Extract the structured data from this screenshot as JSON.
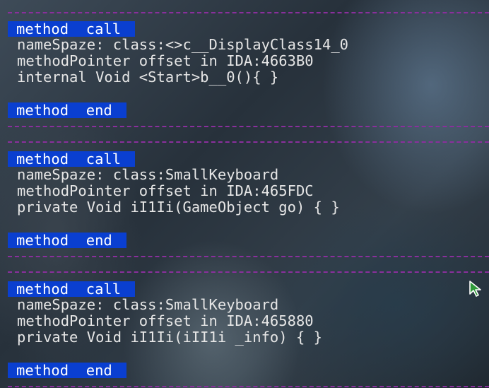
{
  "blocks": [
    {
      "header": "method  call",
      "namespace": "nameSpaze: class:<>c__DisplayClass14_0",
      "pointer": "methodPointer offset in IDA:4663B0",
      "signature": "internal Void <Start>b__0(){ }",
      "footer": "method  end"
    },
    {
      "header": "method  call",
      "namespace": "nameSpaze: class:SmallKeyboard",
      "pointer": "methodPointer offset in IDA:465FDC",
      "signature": "private Void iI1Ii(GameObject go) { }",
      "footer": "method  end"
    },
    {
      "header": "method  call",
      "namespace": "nameSpaze: class:SmallKeyboard",
      "pointer": "methodPointer offset in IDA:465880",
      "signature": "private Void iI1Ii(iII1i _info) { }",
      "footer": "method  end"
    }
  ],
  "colors": {
    "header_bg": "#0a3fd0",
    "separator": "#8a2f9c",
    "text": "#e6e6e6"
  },
  "cursor": "cursor-arrow-icon"
}
